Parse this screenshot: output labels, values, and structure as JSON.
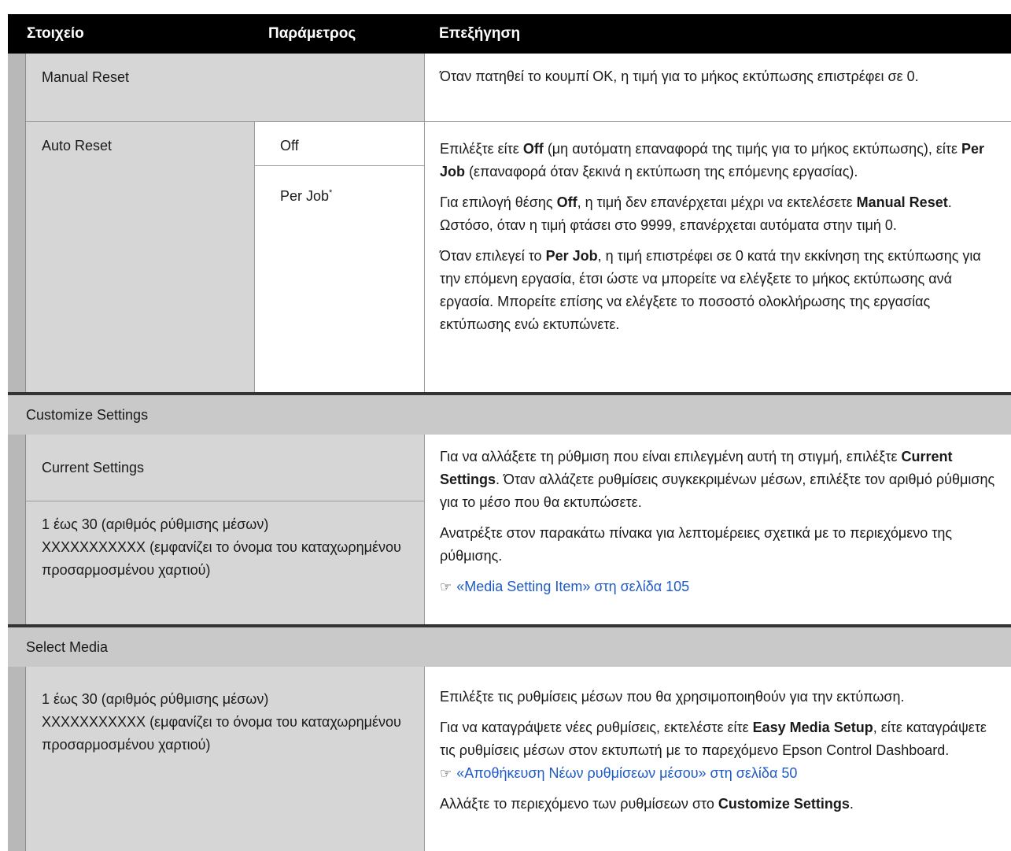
{
  "header": {
    "col1": "Στοιχείο",
    "col2": "Παράμετρος",
    "col3": "Επεξήγηση"
  },
  "manual_reset": {
    "item": "Manual Reset",
    "desc": "Όταν πατηθεί το κουμπί OK, η τιμή για το μήκος εκτύπωσης επιστρέφει σε 0."
  },
  "auto_reset": {
    "item": "Auto Reset",
    "param_off": "Off",
    "param_per_job": "Per Job",
    "default_mark": "*",
    "p1_a": "Επιλέξτε είτε ",
    "p1_b": "Off",
    "p1_c": " (μη αυτόματη επαναφορά της τιμής για το μήκος εκτύ­πωσης), είτε ",
    "p1_d": "Per Job",
    "p1_e": " (επαναφορά όταν ξεκινά η εκτύπωση της επόμενης εργασίας).",
    "p2_a": "Για επιλογή θέσης ",
    "p2_b": "Off",
    "p2_c": ", η τιμή δεν επανέρχεται μέχρι να εκτελέσετε ",
    "p2_d": "Manual Reset",
    "p2_e": ". Ωστόσο, όταν η τιμή φτάσει στο 9999, επανέρχεται αυτό­ματα στην τιμή 0.",
    "p3_a": "Όταν επιλεγεί το ",
    "p3_b": "Per Job",
    "p3_c": ", η τιμή επιστρέφει σε 0 κατά την εκκίνηση της εκτύπωσης για την επόμενη εργασία, έτσι ώστε να μπορείτε να ελέγξετε το μήκος εκτύπωσης ανά εργασία. Μπορείτε επίσης να ελέγξετε το πο­σοστό ολοκλήρωσης της εργασίας εκτύπωσης ενώ εκτυπώνετε."
  },
  "customize": {
    "group": "Customize Settings",
    "current": "Current Settings",
    "range_1": "1 έως 30 (αριθμός ρύθμισης μέσων)",
    "range_2": "XXXXXXXXXXX (εμφανίζει το όνομα του κατα­χωρημένου προσαρμοσμένου χαρτιού)",
    "p1_a": "Για να αλλάξετε τη ρύθμιση που είναι επιλεγμένη αυτή τη στιγμή, επιλέξ­τε ",
    "p1_b": "Current Settings",
    "p1_c": ". Όταν αλλάζετε ρυθμίσεις συγκεκριμένων μέσων, επιλέξτε τον αριθμό ρύθμισης για το μέσο που θα εκτυπώσετε.",
    "p2": "Ανατρέξτε στον παρακάτω πίνακα για λεπτομέρειες σχετικά με το περιε­χόμενο της ρύθμισης.",
    "link": "«Media Setting Item» στη σελίδα 105"
  },
  "select_media": {
    "group": "Select Media",
    "range_1": "1 έως 30 (αριθμός ρύθμισης μέσων)",
    "range_2": "XXXXXXXXXXX (εμφανίζει το όνομα του κατα­χωρημένου προσαρμοσμένου χαρτιού)",
    "p1": "Επιλέξτε τις ρυθμίσεις μέσων που θα χρησιμοποιηθούν για την εκτύπωση.",
    "p2_a": "Για να καταγράψετε νέες ρυθμίσεις, εκτελέστε είτε ",
    "p2_b": "Easy Media Setup",
    "p2_c": ", είτε καταγράψετε τις ρυθμίσεις μέσων στον εκτυπωτή με το παρεχόμε­νο Epson Control Dashboard.",
    "link": "«Αποθήκευση Νέων ρυθμίσεων μέσου» στη σελίδα 50",
    "p3_a": "Αλλάξτε το περιεχόμενο των ρυθμίσεων στο ",
    "p3_b": "Customize Settings",
    "p3_c": "."
  },
  "icons": {
    "reference": "reference-arrow-icon"
  }
}
